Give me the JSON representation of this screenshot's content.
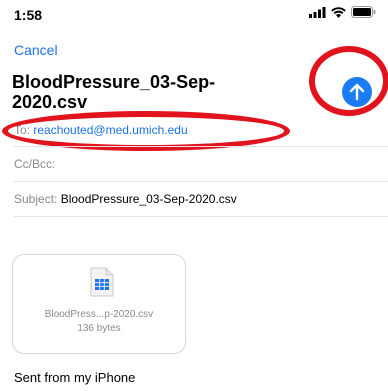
{
  "status_bar": {
    "time": "1:58",
    "icons": [
      "cellular-signal-icon",
      "wifi-icon",
      "battery-icon"
    ]
  },
  "compose": {
    "cancel_label": "Cancel",
    "title": "BloodPressure_03-Sep-2020.csv",
    "send_icon": "arrow-up-icon",
    "to_label": "To:",
    "to_value": "reachouted@med.umich.edu",
    "ccbcc_label": "Cc/Bcc:",
    "subject_label": "Subject:",
    "subject_value": "BloodPressure_03-Sep-2020.csv"
  },
  "attachment": {
    "icon": "spreadsheet-file-icon",
    "name": "BloodPress...p-2020.csv",
    "size": "136 bytes"
  },
  "body_text": "Sent from my iPhone",
  "colors": {
    "accent": "#1a73e8",
    "send_button": "#1c7cf4",
    "annotation_ring": "#e1141d",
    "secondary_text": "#8a8a8e"
  }
}
